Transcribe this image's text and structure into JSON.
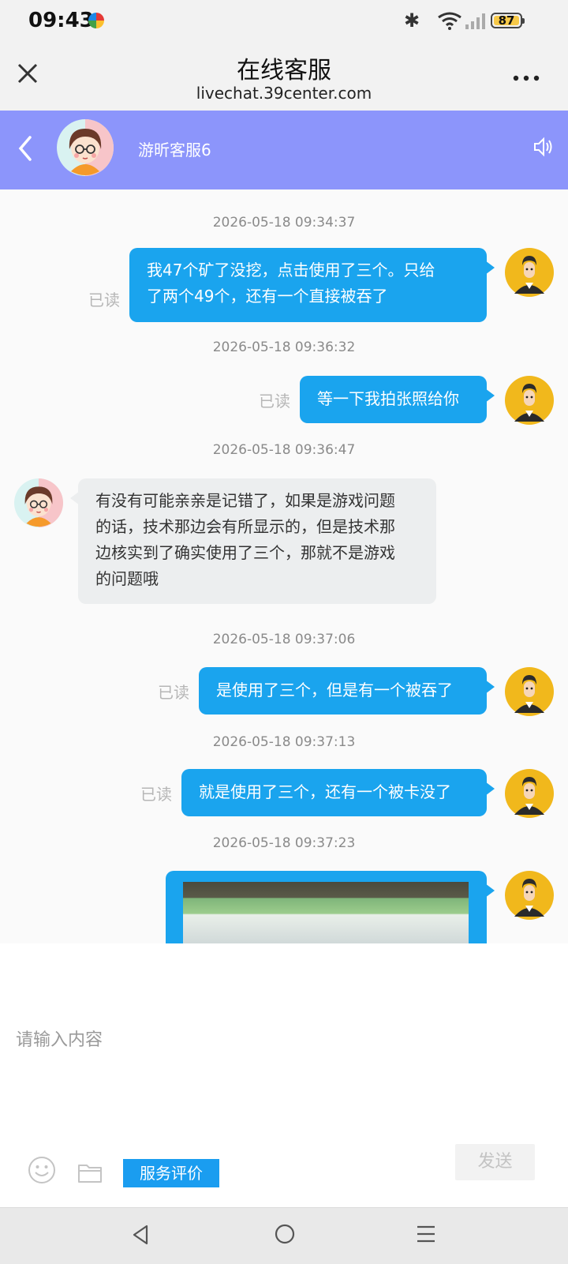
{
  "status_bar": {
    "time": "09:43",
    "battery": "87"
  },
  "browser": {
    "title": "在线客服",
    "url": "livechat.39center.com"
  },
  "chat_header": {
    "agent_name": "游昕客服6"
  },
  "messages": [
    {
      "timestamp": "2026-05-18 09:34:37",
      "side": "user",
      "lines": [
        "我47个矿了没挖，点击使用了三个。只给",
        "了两个49个，还有一个直接被吞了"
      ],
      "status": "已读"
    },
    {
      "timestamp": "2026-05-18 09:36:32",
      "side": "user",
      "lines": [
        "等一下我拍张照给你"
      ],
      "status": "已读"
    },
    {
      "timestamp": "2026-05-18 09:36:47",
      "side": "agent",
      "lines": [
        "有没有可能亲亲是记错了，如果是游戏问题",
        "的话，技术那边会有所显示的，但是技术那",
        "边核实到了确实使用了三个，那就不是游戏",
        "的问题哦"
      ]
    },
    {
      "timestamp": "2026-05-18 09:37:06",
      "side": "user",
      "lines": [
        "是使用了三个，但是有一个被吞了"
      ],
      "status": "已读"
    },
    {
      "timestamp": "2026-05-18 09:37:13",
      "side": "user",
      "lines": [
        "就是使用了三个，还有一个被卡没了"
      ],
      "status": "已读"
    },
    {
      "timestamp": "2026-05-18 09:37:23",
      "side": "user",
      "type": "image"
    }
  ],
  "input": {
    "placeholder": "请输入内容",
    "rate_label": "服务评价",
    "send_label": "发送"
  },
  "icons": [
    "close-icon",
    "more-icon",
    "back-icon",
    "speaker-icon",
    "emoji-icon",
    "folder-icon",
    "nav-back-icon",
    "nav-home-icon",
    "nav-menu-icon"
  ],
  "colors": {
    "header": "#8c95fb",
    "user_bubble": "#1aa4ee",
    "agent_bubble": "#eceeef",
    "rate_button": "#1a9df0"
  }
}
